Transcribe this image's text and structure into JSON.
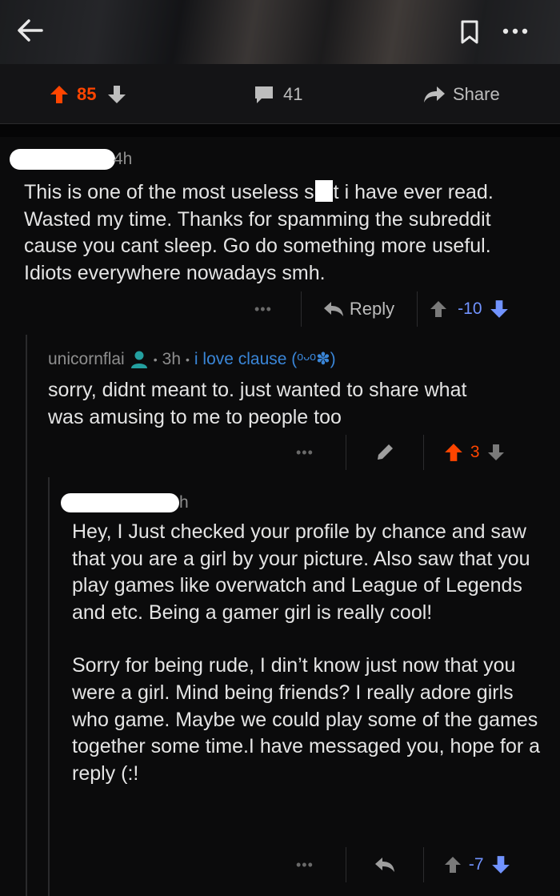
{
  "header": {
    "back_icon": "back-arrow-icon",
    "bookmark_icon": "bookmark-icon",
    "more_icon": "more-options-icon"
  },
  "post_bar": {
    "score": "85",
    "comment_count": "41",
    "share_label": "Share",
    "upvote_color": "#ff4500"
  },
  "comments": [
    {
      "author": "",
      "age": "4h",
      "body_part1": "This is one of the most useless s",
      "body_part2": "t i have ever read. Wasted my time. Thanks for spamming the subreddit cause you cant sleep. Go do something more useful. Idiots everywhere nowadays smh.",
      "reply_label": "Reply",
      "score": "-10",
      "vote_state": "downvoted",
      "vote_color": "#7193ff"
    },
    {
      "author": "unicornflai",
      "age": "3h",
      "flair": "i love clause (ᵒᵕᵒ✽)",
      "separator": "•",
      "body": "sorry, didnt meant to. just wanted to share what was amusing to me to people too",
      "score": "3",
      "vote_state": "upvoted",
      "vote_color": "#ff4500"
    },
    {
      "author": "",
      "age": "h",
      "body_paragraph1": "Hey, I Just checked your profile by chance and saw that you are a girl by your picture. Also saw that you play games like overwatch and League of Legends and etc. Being a gamer girl is really cool!",
      "body_paragraph2": "Sorry for being rude, I din’t know just now that you were a girl. Mind being friends? I really adore girls who game. Maybe we could play some of the games together some time.I have messaged you, hope for a reply (:!",
      "score": "-7",
      "vote_state": "downvoted",
      "vote_color": "#7193ff"
    }
  ],
  "colors": {
    "background": "#0b0b0c",
    "upvote": "#ff4500",
    "downvote": "#7193ff",
    "flair": "#3a86d8",
    "op_badge": "#24a0a0"
  }
}
